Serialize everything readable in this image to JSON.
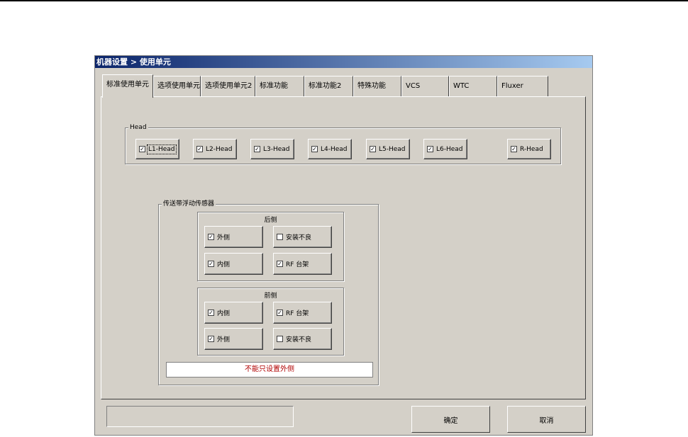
{
  "window": {
    "title": "机器设置 > 使用单元"
  },
  "tabs": [
    {
      "label": "标准使用单元",
      "active": true
    },
    {
      "label": "选项使用单元",
      "active": false
    },
    {
      "label": "选项使用单元2",
      "active": false
    },
    {
      "label": "标准功能",
      "active": false
    },
    {
      "label": "标准功能2",
      "active": false
    },
    {
      "label": "特殊功能",
      "active": false
    },
    {
      "label": "VCS",
      "active": false
    },
    {
      "label": "WTC",
      "active": false
    },
    {
      "label": "Fluxer",
      "active": false
    }
  ],
  "head_group": {
    "label": "Head",
    "items": [
      {
        "label": "L1-Head",
        "checked": true
      },
      {
        "label": "L2-Head",
        "checked": true
      },
      {
        "label": "L3-Head",
        "checked": true
      },
      {
        "label": "L4-Head",
        "checked": true
      },
      {
        "label": "L5-Head",
        "checked": true
      },
      {
        "label": "L6-Head",
        "checked": true
      },
      {
        "label": "R-Head",
        "checked": true
      }
    ]
  },
  "sensor_group": {
    "label": "传送带浮动传感器",
    "rear": {
      "label": "后侧",
      "items": [
        {
          "label": "外侧",
          "checked": true
        },
        {
          "label": "安装不良",
          "checked": false
        },
        {
          "label": "内侧",
          "checked": true
        },
        {
          "label": "RF 台架",
          "checked": true
        }
      ]
    },
    "front": {
      "label": "前侧",
      "items": [
        {
          "label": "内侧",
          "checked": true
        },
        {
          "label": "RF 台架",
          "checked": true
        },
        {
          "label": "外侧",
          "checked": true
        },
        {
          "label": "安装不良",
          "checked": false
        }
      ]
    },
    "warning": "不能只设置外侧"
  },
  "buttons": {
    "ok": "确定",
    "cancel": "取消"
  },
  "check_glyph": "✓"
}
